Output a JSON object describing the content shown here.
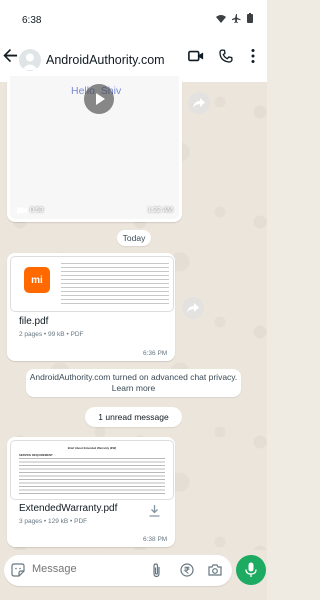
{
  "status_bar": {
    "time": "6:38"
  },
  "header": {
    "contact_name": "AndroidAuthority.com"
  },
  "messages": {
    "video": {
      "thumb_text": "Hello, Shiv",
      "duration": "0:53",
      "time": "1:22 AM"
    },
    "date_separator": "Today",
    "file1": {
      "name": "file.pdf",
      "meta": "2 pages • 99 kB • PDF",
      "time": "6:36 PM",
      "thumb_brand": "mi"
    },
    "system_notice": {
      "line1": "AndroidAuthority.com turned on advanced chat privacy.",
      "line2": "Learn more"
    },
    "unread": "1 unread message",
    "file2": {
      "name": "ExtendedWarranty.pdf",
      "meta": "3 pages • 129 kB • PDF",
      "time": "6:38 PM",
      "doc_title": "Brief About Extended Warranty (EW)",
      "doc_heading": "SERVICE REQUIREMENT"
    }
  },
  "composer": {
    "placeholder": "Message"
  },
  "colors": {
    "accent_green": "#1daa61",
    "chat_bg": "#efeae2",
    "bubble": "#ffffff"
  }
}
